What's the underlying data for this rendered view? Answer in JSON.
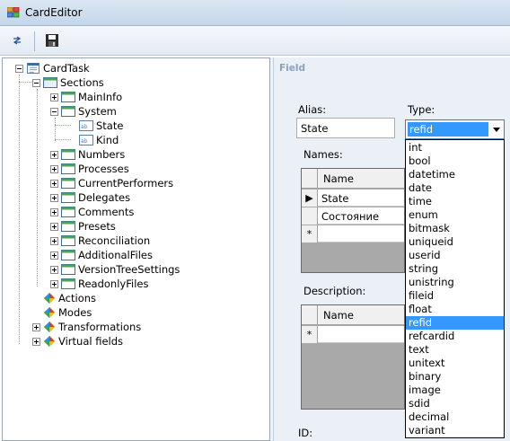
{
  "window": {
    "title": "CardEditor"
  },
  "toolbar": {
    "buttons": [
      {
        "icon": "properties-icon"
      },
      {
        "icon": "save-icon"
      }
    ]
  },
  "tree": {
    "root": "CardTask",
    "sections": "Sections",
    "main_info": "MainInfo",
    "system": "System",
    "state": "State",
    "kind": "Kind",
    "numbers": "Numbers",
    "processes": "Processes",
    "current_performers": "CurrentPerformers",
    "delegates": "Delegates",
    "comments": "Comments",
    "presets": "Presets",
    "reconciliation": "Reconciliation",
    "additional_files": "AdditionalFiles",
    "version_tree_settings": "VersionTreeSettings",
    "readonly_files": "ReadonlyFiles",
    "actions": "Actions",
    "modes": "Modes",
    "transformations": "Transformations",
    "virtual_fields": "Virtual fields"
  },
  "field": {
    "group_title": "Field",
    "alias_label": "Alias:",
    "alias_value": "State",
    "type_label": "Type:",
    "type_value": "refid",
    "names_label": "Names:",
    "names_grid": {
      "column": "Name",
      "rows": [
        "State",
        "Состояние"
      ],
      "current_row_marker": "▶",
      "new_row_marker": "*"
    },
    "description_label": "Description:",
    "description_grid": {
      "column": "Name",
      "new_row_marker": "*"
    },
    "id_label": "ID:"
  },
  "type_options": [
    "int",
    "bool",
    "datetime",
    "date",
    "time",
    "enum",
    "bitmask",
    "uniqueid",
    "userid",
    "string",
    "unistring",
    "fileid",
    "float",
    "refid",
    "refcardid",
    "text",
    "unitext",
    "binary",
    "image",
    "sdid",
    "decimal",
    "variant"
  ],
  "selected_type": "refid",
  "colors": {
    "selection": "#3399ff",
    "panel_bg": "#eaf0f6",
    "group_title": "#8aa1bc"
  }
}
